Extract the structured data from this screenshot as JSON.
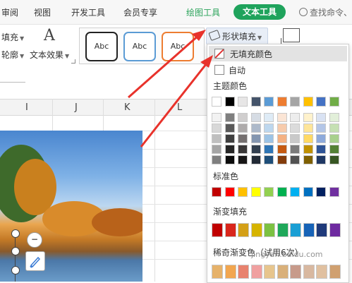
{
  "tabs": {
    "review": "审阅",
    "view": "视图",
    "dev_tools": "开发工具",
    "member": "会员专享",
    "draw_tools": "绘图工具",
    "text_tools": "文本工具"
  },
  "search": {
    "placeholder": "查找命令、"
  },
  "ribbon": {
    "fill_label": "填充",
    "outline_label": "轮廓",
    "text_effects_label": "文本效果",
    "text_effects_icon": "A",
    "style_samples": [
      "Abc",
      "Abc",
      "Abc"
    ],
    "shape_fill_label": "形状填充"
  },
  "sheet": {
    "columns": [
      "I",
      "J",
      "K",
      "L"
    ]
  },
  "dropdown": {
    "no_fill": "无填充颜色",
    "auto": "自动",
    "theme_colors_title": "主题颜色",
    "standard_colors_title": "标准色",
    "gradient_fill_title": "渐变填充",
    "rare_gradient_title": "稀奇渐变色（试用6次）",
    "theme_top_row": [
      "#ffffff",
      "#000000",
      "#e7e6e6",
      "#44546a",
      "#5b9bd5",
      "#ed7d31",
      "#a5a5a5",
      "#ffc000",
      "#4472c4",
      "#70ad47"
    ],
    "theme_shades": [
      [
        "#f2f2f2",
        "#7f7f7f",
        "#d0cece",
        "#d6dce4",
        "#deebf6",
        "#fbe5d5",
        "#ededed",
        "#fff2cc",
        "#d9e2f3",
        "#e2efd9"
      ],
      [
        "#d8d8d8",
        "#595959",
        "#aeabab",
        "#adb9ca",
        "#bdd7ee",
        "#f7cbac",
        "#dbdbdb",
        "#fee599",
        "#b4c6e7",
        "#c5e0b3"
      ],
      [
        "#bfbfbf",
        "#3f3f3f",
        "#757070",
        "#8496b0",
        "#9cc3e5",
        "#f4b183",
        "#c9c9c9",
        "#ffd965",
        "#8eaadb",
        "#a8d08d"
      ],
      [
        "#a5a5a5",
        "#262626",
        "#3a3838",
        "#323f4f",
        "#2e75b5",
        "#c55a11",
        "#7b7b7b",
        "#bf9000",
        "#2f5496",
        "#538135"
      ],
      [
        "#7f7f7f",
        "#0c0c0c",
        "#171616",
        "#222a35",
        "#1e4e79",
        "#833c0b",
        "#525252",
        "#7f6000",
        "#1f3864",
        "#375623"
      ]
    ],
    "standard_colors": [
      "#c00000",
      "#ff0000",
      "#ffc000",
      "#ffff00",
      "#92d050",
      "#00b050",
      "#00b0f0",
      "#0070c0",
      "#002060",
      "#7030a0"
    ],
    "gradient_colors": [
      "#c00000",
      "#d9261c",
      "#d4a017",
      "#d6b400",
      "#7cc142",
      "#1fa85a",
      "#1a9fd4",
      "#1763b7",
      "#1f3a7a",
      "#6e2aa0"
    ],
    "rare_gradient_colors": [
      "#e6b26a",
      "#f2a64f",
      "#e8826e",
      "#f0a0a0",
      "#e7c58d",
      "#d9b07a",
      "#c79a8a",
      "#d8b8a0",
      "#e0c0a0",
      "#d0a070"
    ]
  },
  "watermark": "jingyan.baidu.com",
  "accent_colors": {
    "text_tools_tab": "#1fa35c",
    "annotation_arrow": "#e8322b"
  }
}
